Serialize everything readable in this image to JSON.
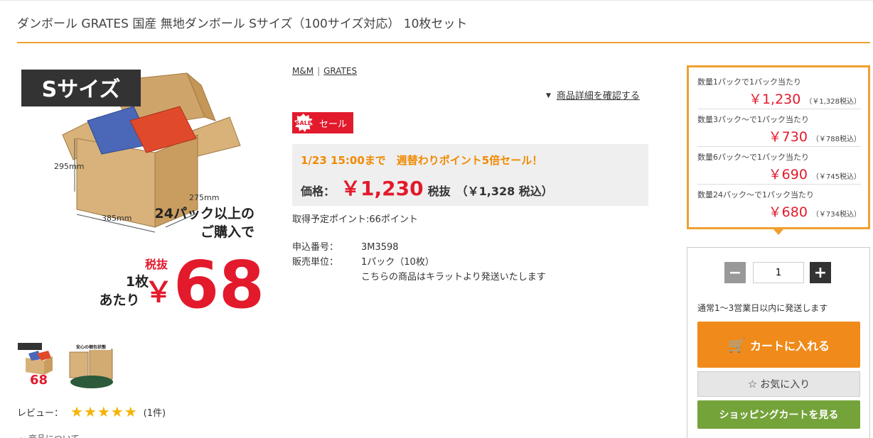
{
  "product": {
    "title": "ダンボール GRATES 国産 無地ダンボール Sサイズ（100サイズ対応） 10枚セット"
  },
  "image": {
    "size_badge": "Sサイズ",
    "dim_height": "295mm",
    "dim_depth": "275mm",
    "dim_width": "385mm",
    "line1": "24パック以上の",
    "line2": "ご購入で",
    "per_unit_1": "1枚",
    "per_unit_2": "あたり",
    "tax_ex": "税抜",
    "yen": "￥",
    "big_price": "68"
  },
  "thumb2": {
    "caption": "安心の梱包状態"
  },
  "review": {
    "label": "レビュー：",
    "stars": "★★★★★",
    "count": "(1件)"
  },
  "more": "・ 商品について",
  "brands": {
    "b1": "M&M",
    "sep": "|",
    "b2": "GRATES"
  },
  "details_link": {
    "marker": "▼",
    "label": "商品詳細を確認する"
  },
  "sale": {
    "burst": "SALE",
    "label": "セール"
  },
  "promo": {
    "text": "1/23 15:00まで　週替わりポイント5倍セール！",
    "price_label": "価格：",
    "price": "￥1,230",
    "tax_label": "税抜",
    "incl": "（￥1,328 税込）"
  },
  "points": "取得予定ポイント:66ポイント",
  "spec": {
    "order_no_k": "申込番号：",
    "order_no_v": "3M3598",
    "unit_k": "販売単位：",
    "unit_v": "1パック（10枚）",
    "note": "こちらの商品はキラットより発送いたします"
  },
  "tiers": [
    {
      "label": "数量1パックで1パック当たり",
      "price": "￥1,230",
      "tax": "（￥1,328税込）"
    },
    {
      "label": "数量3パック～で1パック当たり",
      "price": "￥730",
      "tax": "（￥788税込）"
    },
    {
      "label": "数量6パック～で1パック当たり",
      "price": "￥690",
      "tax": "（￥745税込）"
    },
    {
      "label": "数量24パック～で1パック当たり",
      "price": "￥680",
      "tax": "（￥734税込）"
    }
  ],
  "cart": {
    "minus": "−",
    "plus": "+",
    "qty": "1",
    "shipping": "通常1～3営業日以内に発送します",
    "add_icon": "🛒",
    "add_label": "カートに入れる",
    "fav_icon": "☆",
    "fav_label": "お気に入り",
    "view_label": "ショッピングカートを見る"
  },
  "colors": {
    "accent_orange": "#f0a030",
    "price_red": "#e21a2c",
    "cart_orange": "#f08a1a",
    "view_green": "#74a33a"
  }
}
